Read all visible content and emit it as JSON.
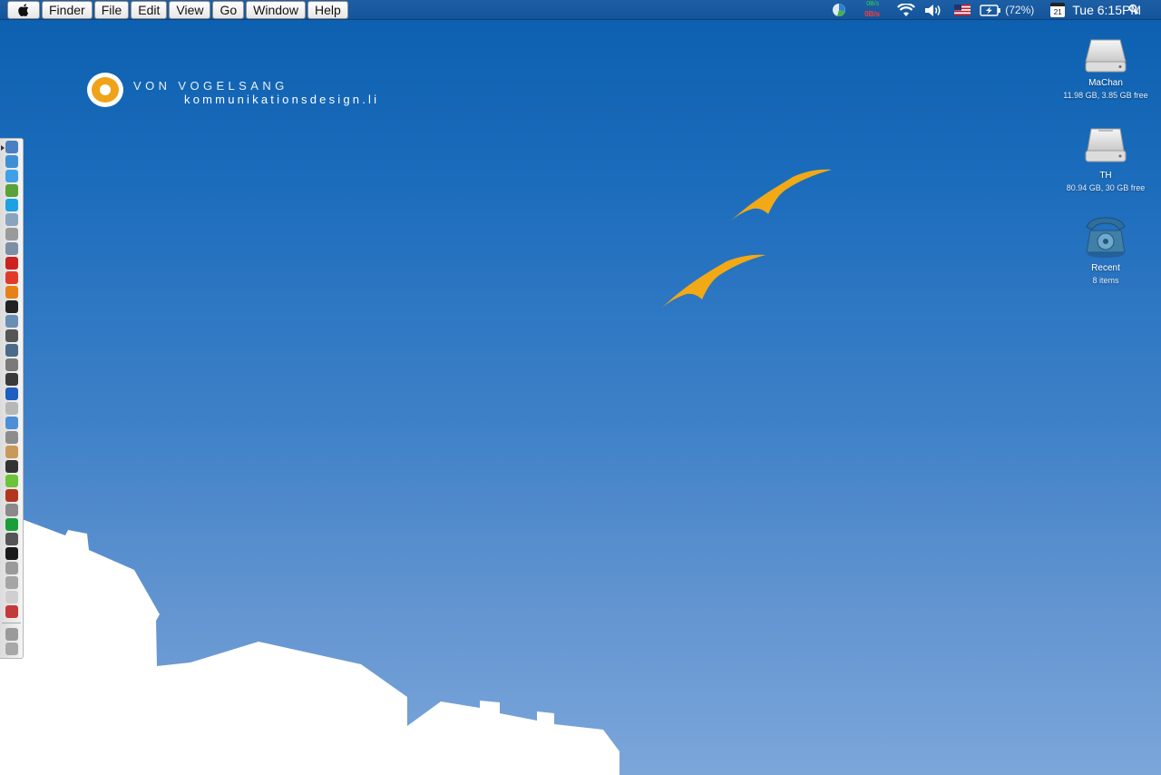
{
  "menubar": {
    "apple_icon": "apple-icon",
    "items": [
      "Finder",
      "File",
      "Edit",
      "View",
      "Go",
      "Window",
      "Help"
    ],
    "status": {
      "net_up": "0B/s",
      "net_down": "0B/s",
      "battery": "(72%)",
      "calendar_day": "21",
      "clock": "Tue 6:15PM"
    }
  },
  "logo": {
    "name": "VON VOGELSANG",
    "sub": "kommunikationsdesign.li"
  },
  "desktop_icons": [
    {
      "name": "MaChan",
      "sub": "11.98 GB, 3.85 GB free",
      "icon": "hard-drive-icon"
    },
    {
      "name": "TH",
      "sub": "80.94 GB, 30 GB free",
      "icon": "hard-drive-icon"
    },
    {
      "name": "Recent",
      "sub": "8 items",
      "icon": "telephone-icon"
    }
  ],
  "colors": {
    "menubar": "#14549a",
    "sky_top": "#0b5fae",
    "sky_bottom": "#7ba6da",
    "bird": "#f2a916",
    "logo_orange": "#f0a318"
  },
  "dock_items": [
    {
      "icon": "finder-icon",
      "color": "#4a7fc1"
    },
    {
      "icon": "globe-icon",
      "color": "#3e8fd6"
    },
    {
      "icon": "chat-icon",
      "color": "#3fa0e8"
    },
    {
      "icon": "adium-icon",
      "color": "#5aa13a"
    },
    {
      "icon": "skype-icon",
      "color": "#1da1e2"
    },
    {
      "icon": "network-icon",
      "color": "#8aa4c0"
    },
    {
      "icon": "photo-icon",
      "color": "#9a9a9a"
    },
    {
      "icon": "preview-icon",
      "color": "#7b8fa6"
    },
    {
      "icon": "record-icon",
      "color": "#cc2222"
    },
    {
      "icon": "dp-icon",
      "color": "#e03b2a"
    },
    {
      "icon": "vlc-icon",
      "color": "#e8801a"
    },
    {
      "icon": "keyboard-icon",
      "color": "#222222"
    },
    {
      "icon": "disk-utility-icon",
      "color": "#6a8fb5"
    },
    {
      "icon": "bug-icon",
      "color": "#555555"
    },
    {
      "icon": "script-icon",
      "color": "#4a6a8a"
    },
    {
      "icon": "font-icon",
      "color": "#7a7a7a"
    },
    {
      "icon": "wrench-icon",
      "color": "#3a3a3a"
    },
    {
      "icon": "info-icon",
      "color": "#1e5ec2"
    },
    {
      "icon": "package-icon",
      "color": "#b7b7b7"
    },
    {
      "icon": "box-icon",
      "color": "#4e8ed6"
    },
    {
      "icon": "tool-icon",
      "color": "#8c8c8c"
    },
    {
      "icon": "notes-icon",
      "color": "#c79a5a"
    },
    {
      "icon": "pen-icon",
      "color": "#333333"
    },
    {
      "icon": "media-icon",
      "color": "#6cc43a"
    },
    {
      "icon": "spider-icon",
      "color": "#b2361f"
    },
    {
      "icon": "radio-icon",
      "color": "#8a8a8a"
    },
    {
      "icon": "spotify-icon",
      "color": "#1a9e3a"
    },
    {
      "icon": "calendar-icon",
      "color": "#555555"
    },
    {
      "icon": "terminal-icon",
      "color": "#1a1a1a"
    },
    {
      "icon": "system-icon",
      "color": "#9a9a9a"
    },
    {
      "icon": "grapher-icon",
      "color": "#a5a5a5"
    },
    {
      "icon": "tag-icon",
      "color": "#cfcfcf"
    },
    {
      "icon": "clock-icon",
      "color": "#c33a3a"
    },
    {
      "icon": "documents-icon",
      "color": "#9a9a9a"
    },
    {
      "icon": "trash-icon",
      "color": "#a8a8a8"
    }
  ]
}
